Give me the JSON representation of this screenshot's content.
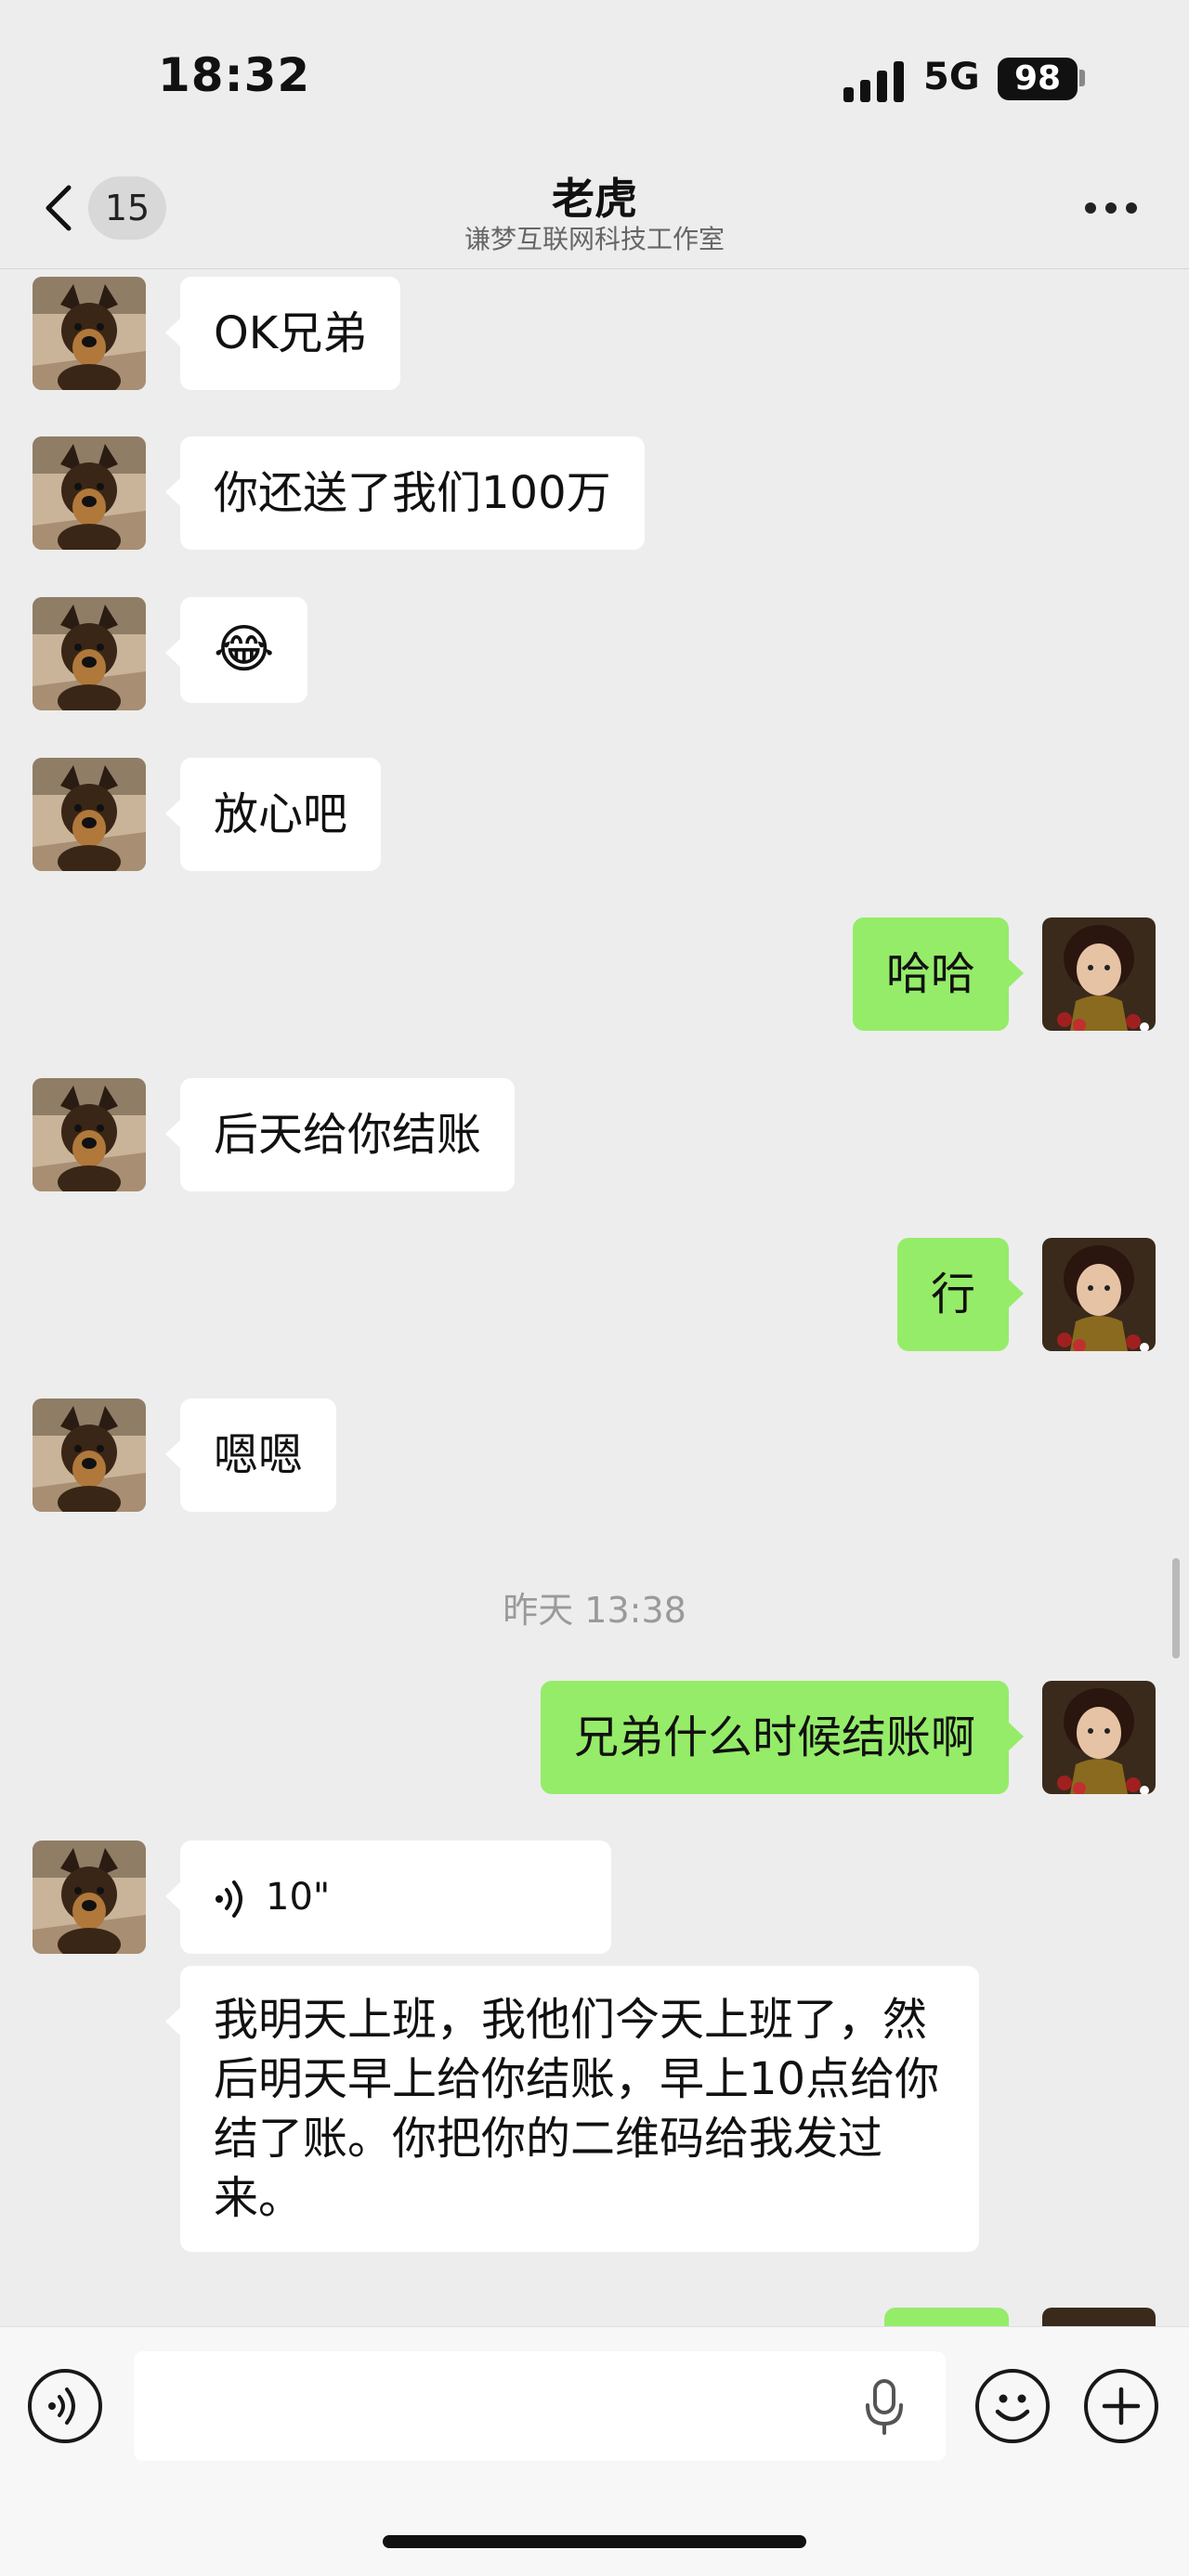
{
  "status_bar": {
    "time": "18:32",
    "network": "5G",
    "battery": "98"
  },
  "header": {
    "unread_count": "15",
    "title": "老虎",
    "subtitle": "谦梦互联网科技工作室"
  },
  "messages": [
    {
      "side": "left",
      "text": "OK兄弟"
    },
    {
      "side": "left",
      "text": "你还送了我们100万"
    },
    {
      "side": "left",
      "text": "😂"
    },
    {
      "side": "left",
      "text": "放心吧"
    },
    {
      "side": "right",
      "text": "哈哈"
    },
    {
      "side": "left",
      "text": "后天给你结账"
    },
    {
      "side": "right",
      "text": "行"
    },
    {
      "side": "left",
      "text": "嗯嗯"
    },
    {
      "side": "right",
      "text": "兄弟什么时候结账啊"
    },
    {
      "side": "left",
      "voice_duration": "10\""
    },
    {
      "side": "left",
      "text": "我明天上班，我他们今天上班了，然后明天早上给你结账，早上10点给你结了账。你把你的二维码给我发过来。"
    }
  ],
  "timestamp": "昨天 13:38",
  "input": {
    "value": "",
    "placeholder": ""
  },
  "icons": {
    "back": "chevron-left-icon",
    "more": "more-dots-icon",
    "voice_mode": "voice-mode-icon",
    "mic": "microphone-icon",
    "emoji": "emoji-icon",
    "plus": "plus-icon"
  },
  "colors": {
    "background": "#ededed",
    "sent_bubble": "#95ec69",
    "received_bubble": "#ffffff"
  }
}
